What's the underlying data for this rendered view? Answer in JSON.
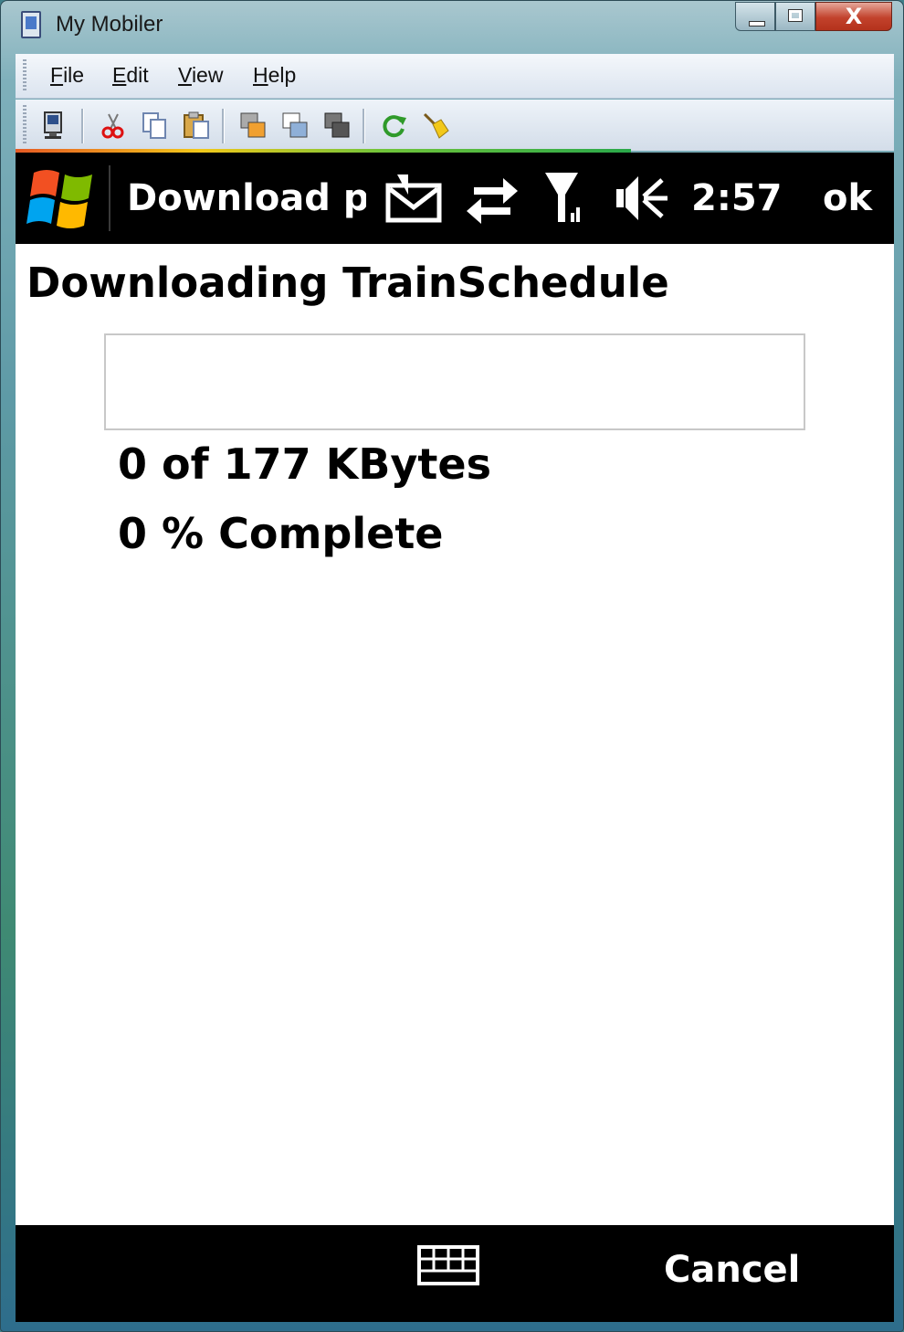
{
  "window": {
    "title": "My Mobiler",
    "close_glyph": "X"
  },
  "menu": {
    "items": [
      "File",
      "Edit",
      "View",
      "Help"
    ]
  },
  "toolbar": {
    "icons": [
      "device-icon",
      "cut-icon",
      "copy-icon",
      "paste-icon",
      "window-front-icon",
      "window-cascade-icon",
      "window-back-icon",
      "refresh-icon",
      "clean-icon"
    ]
  },
  "device": {
    "statusbar": {
      "title": "Download progress",
      "time": "2:57",
      "ok_label": "ok",
      "icons": [
        "message-icon",
        "sync-icon",
        "signal-icon",
        "volume-icon"
      ]
    },
    "heading": "Downloading TrainSchedule",
    "progress": {
      "fraction": 0.0
    },
    "size_text": "0 of 177 KBytes",
    "percent_text": "0 % Complete",
    "softkeys": {
      "right": "Cancel",
      "center_icon": "keyboard-icon"
    }
  }
}
